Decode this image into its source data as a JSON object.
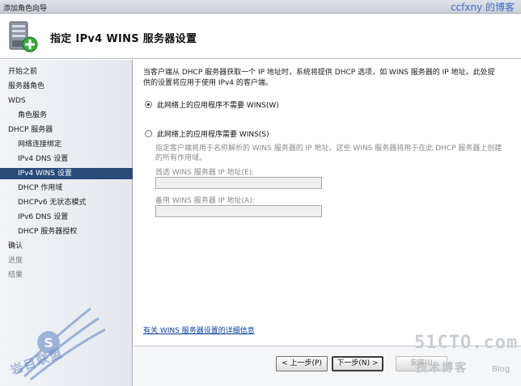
{
  "window": {
    "title": "添加角色向导",
    "blog_label": "ccfxny 的博客"
  },
  "header": {
    "title": "指定 IPv4 WINS 服务器设置"
  },
  "sidebar": {
    "items": [
      {
        "label": "开始之前",
        "level": 0,
        "state": "normal"
      },
      {
        "label": "服务器角色",
        "level": 0,
        "state": "normal"
      },
      {
        "label": "WDS",
        "level": 0,
        "state": "normal"
      },
      {
        "label": "角色服务",
        "level": 1,
        "state": "normal"
      },
      {
        "label": "DHCP 服务器",
        "level": 0,
        "state": "normal"
      },
      {
        "label": "网络连接绑定",
        "level": 1,
        "state": "normal"
      },
      {
        "label": "IPv4 DNS 设置",
        "level": 1,
        "state": "normal"
      },
      {
        "label": "IPv4 WINS 设置",
        "level": 1,
        "state": "active"
      },
      {
        "label": "DHCP 作用域",
        "level": 1,
        "state": "normal"
      },
      {
        "label": "DHCPv6 无状态模式",
        "level": 1,
        "state": "normal"
      },
      {
        "label": "IPv6 DNS 设置",
        "level": 1,
        "state": "normal"
      },
      {
        "label": "DHCP 服务器授权",
        "level": 1,
        "state": "normal"
      },
      {
        "label": "确认",
        "level": 0,
        "state": "normal"
      },
      {
        "label": "进度",
        "level": 0,
        "state": "disabled"
      },
      {
        "label": "结果",
        "level": 0,
        "state": "disabled"
      }
    ]
  },
  "content": {
    "intro": "当客户端从 DHCP 服务器获取一个 IP 地址时，系统将提供 DHCP 选项，如 WINS 服务器的 IP 地址。此处提供的设置将应用于使用 IPv4 的客户端。",
    "option_not_required": "此网络上的应用程序不需要 WINS(W)",
    "option_required": "此网络上的应用程序需要 WINS(S)",
    "selected_option": "not_required",
    "required_desc": "指定客户端将用于名称解析的 WINS 服务器的 IP 地址。这些 WINS 服务器将用于在此 DHCP 服务器上创建的所有作用域。",
    "preferred_label": "首选 WINS 服务器 IP 地址(E):",
    "preferred_value": "",
    "alternate_label": "备用 WINS 服务器 IP 地址(A):",
    "alternate_value": "",
    "more_info_link": "有关 WINS 服务器设置的详细信息"
  },
  "footer": {
    "back": "< 上一步(P)",
    "next": "下一步(N) >",
    "install": "安装(I)"
  },
  "watermarks": {
    "left_text": "岩目联盟",
    "site": "51CTO.com",
    "tag": "技术博客",
    "blog": "Blog"
  }
}
